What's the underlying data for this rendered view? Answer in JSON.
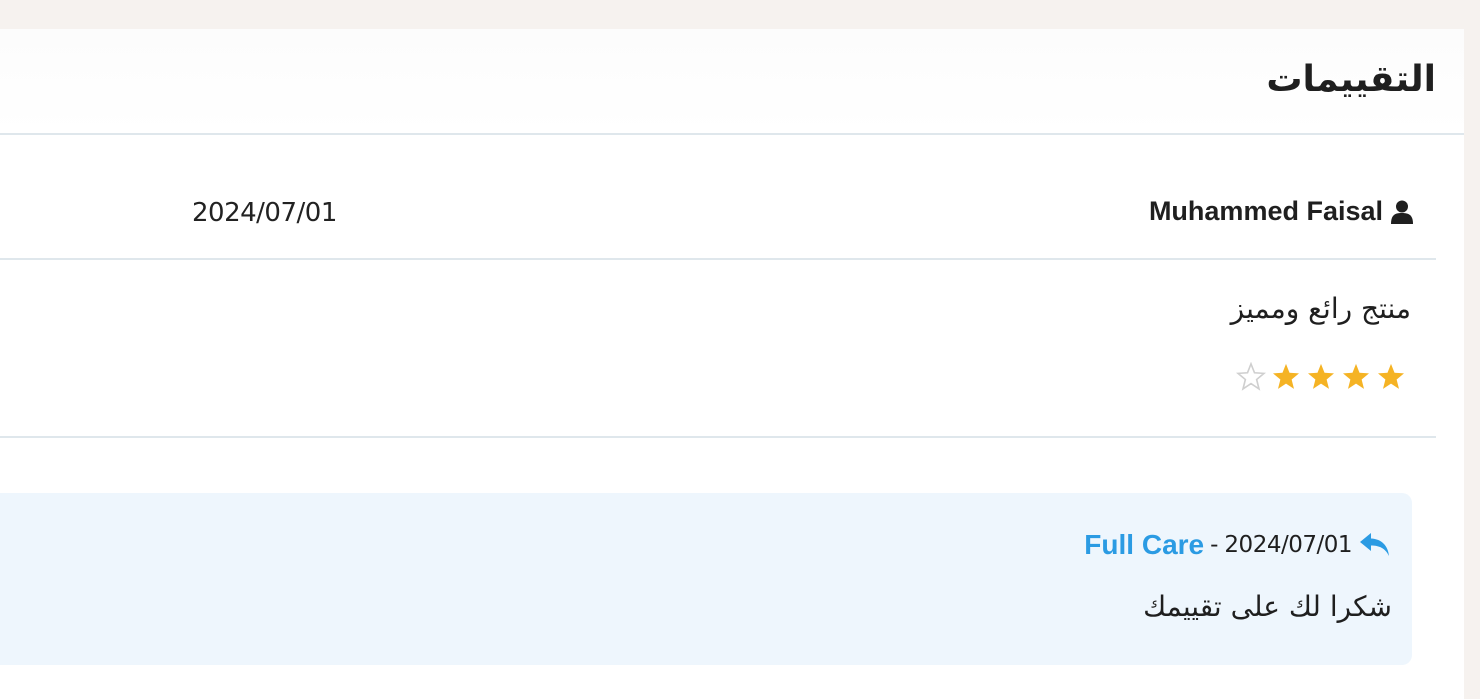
{
  "section": {
    "title": "التقييمات"
  },
  "review": {
    "reviewer_name": "Muhammed Faisal",
    "reviewer_icon": "user-icon",
    "date": "2024/07/01",
    "text": "منتج رائع ومميز",
    "rating": 4,
    "max_rating": 5
  },
  "reply": {
    "icon": "reply-icon",
    "author": "Full Care",
    "separator": "-",
    "date": "2024/07/01",
    "text": "شكرا لك على تقييمك"
  },
  "colors": {
    "star_filled": "#f5b324",
    "star_empty": "#cfcfcf",
    "accent": "#2b9be3",
    "reply_bg": "#eef6fd",
    "divider": "#dfe7ec"
  }
}
